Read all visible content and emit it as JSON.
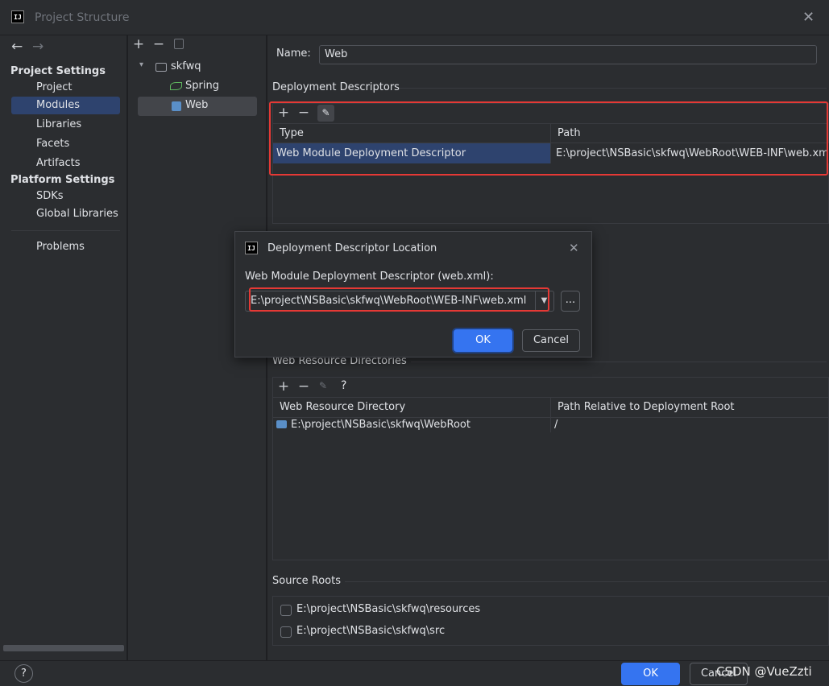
{
  "window": {
    "title": "Project Structure",
    "logo_text": "IJ",
    "close_icon": "close-icon"
  },
  "left_nav": {
    "project_settings_label": "Project Settings",
    "project_settings_items": [
      "Project",
      "Modules",
      "Libraries",
      "Facets",
      "Artifacts"
    ],
    "selected_item": "Modules",
    "platform_settings_label": "Platform Settings",
    "platform_settings_items": [
      "SDKs",
      "Global Libraries"
    ],
    "problems_label": "Problems"
  },
  "module_tree": {
    "root": "skfwq",
    "children": [
      "Spring",
      "Web"
    ],
    "selected": "Web"
  },
  "main": {
    "name_label": "Name:",
    "name_value": "Web",
    "deployment_descriptors_label": "Deployment Descriptors",
    "dd_columns": [
      "Type",
      "Path"
    ],
    "dd_rows": [
      {
        "type": "Web Module Deployment Descriptor",
        "path": "E:\\project\\NSBasic\\skfwq\\WebRoot\\WEB-INF\\web.xml"
      }
    ],
    "web_resource_dirs_label": "Web Resource Directories",
    "wr_columns": [
      "Web Resource Directory",
      "Path Relative to Deployment Root"
    ],
    "wr_rows": [
      {
        "dir": "E:\\project\\NSBasic\\skfwq\\WebRoot",
        "rel": "/"
      }
    ],
    "source_roots_label": "Source Roots",
    "source_roots": [
      {
        "path": "E:\\project\\NSBasic\\skfwq\\resources",
        "checked": false
      },
      {
        "path": "E:\\project\\NSBasic\\skfwq\\src",
        "checked": false
      }
    ]
  },
  "dialog": {
    "title": "Deployment Descriptor Location",
    "logo_text": "IJ",
    "field_label": "Web Module Deployment Descriptor (web.xml):",
    "field_value": "E:\\project\\NSBasic\\skfwq\\WebRoot\\WEB-INF\\web.xml",
    "browse_label": "...",
    "ok_label": "OK",
    "cancel_label": "Cancel"
  },
  "bottom": {
    "help_label": "?",
    "ok_label": "OK",
    "cancel_label": "Cancel",
    "watermark": "CSDN @VueZzti"
  },
  "colors": {
    "accent": "#3574f0",
    "selection": "#2e436e",
    "highlight_box": "#e53935",
    "background": "#2b2d30"
  }
}
